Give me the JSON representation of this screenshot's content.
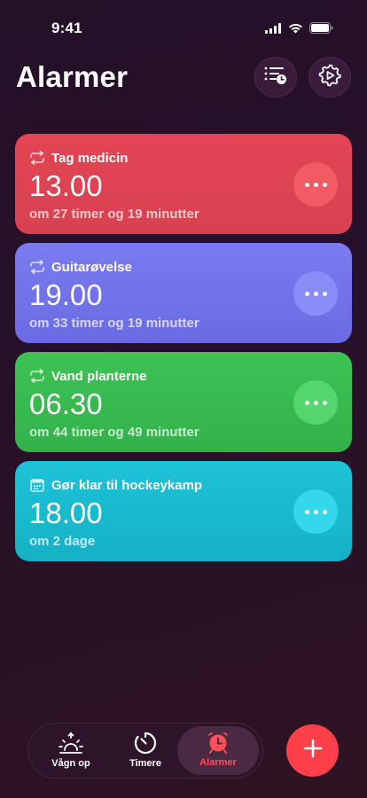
{
  "status_bar": {
    "time": "9:41"
  },
  "header": {
    "title": "Alarmer",
    "list_button_icon": "list-clock-icon",
    "settings_button_icon": "gear-play-icon"
  },
  "alarms": [
    {
      "label": "Tag medicin",
      "time": "13.00",
      "subtitle": "om 27 timer og 19 minutter",
      "icon": "repeat-icon",
      "color": "#e04353"
    },
    {
      "label": "Guitarøvelse",
      "time": "19.00",
      "subtitle": "om 33 timer og 19 minutter",
      "icon": "repeat-icon",
      "color": "#7373ea"
    },
    {
      "label": "Vand planterne",
      "time": "06.30",
      "subtitle": "om 44 timer og 49 minutter",
      "icon": "repeat-icon",
      "color": "#38bb50"
    },
    {
      "label": "Gør klar til hockeykamp",
      "time": "18.00",
      "subtitle": "om 2 dage",
      "icon": "calendar-icon",
      "color": "#1abbd0"
    }
  ],
  "tabbar": {
    "tabs": [
      {
        "label": "Vågn op",
        "icon": "sunrise-icon"
      },
      {
        "label": "Timere",
        "icon": "timer-icon"
      },
      {
        "label": "Alarmer",
        "icon": "alarm-clock-icon"
      }
    ],
    "active_color": "#ff4e57"
  },
  "add_button": {
    "icon": "plus-icon",
    "color": "#ff3f49"
  }
}
